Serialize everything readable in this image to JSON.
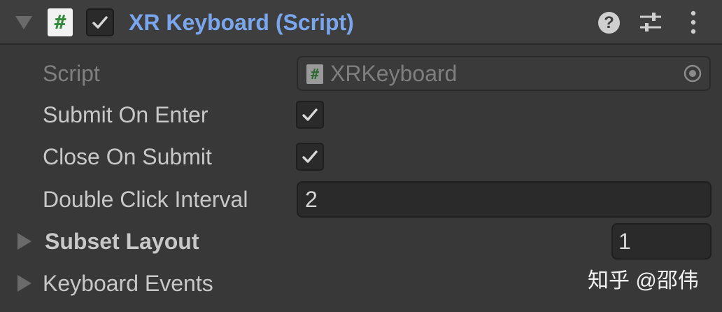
{
  "component": {
    "title": "XR Keyboard (Script)",
    "enabled": true,
    "script_icon_glyph": "#",
    "help_glyph": "?",
    "icons": {
      "foldout": "triangle-down-icon",
      "script": "csharp-script-icon",
      "help": "help-icon",
      "presets": "sliders-icon",
      "more": "kebab-menu-icon"
    }
  },
  "fields": {
    "script": {
      "label": "Script",
      "value": "XRKeyboard",
      "icon_glyph": "#"
    },
    "submit_on_enter": {
      "label": "Submit On Enter",
      "checked": true
    },
    "close_on_submit": {
      "label": "Close On Submit",
      "checked": true
    },
    "double_click_interval": {
      "label": "Double Click Interval",
      "value": "2"
    },
    "subset_layout": {
      "label": "Subset Layout",
      "size": "1"
    },
    "keyboard_events": {
      "label": "Keyboard Events"
    }
  },
  "watermark": "知乎 @邵伟",
  "colors": {
    "background": "#383838",
    "header": "#3e3e3e",
    "title_accent": "#7aa6ee",
    "label": "#c8c8c8",
    "disabled_label": "#7f7f7f",
    "field_bg": "#2a2a2a"
  }
}
